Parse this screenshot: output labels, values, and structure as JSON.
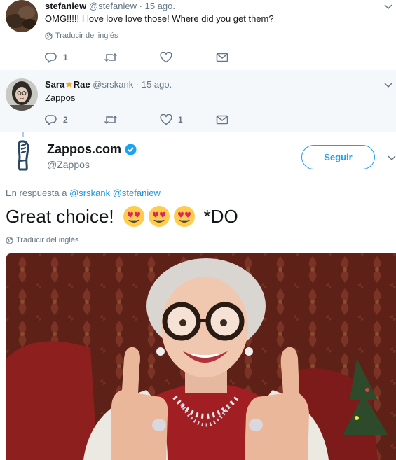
{
  "thread": {
    "replies": [
      {
        "display_name": "stefaniew",
        "handle": "@stefaniew",
        "separator": "·",
        "time": "15 ago.",
        "text": "OMG!!!!!  I love love love those!  Where did you get them?",
        "translate_label": "Traducir del inglés",
        "reply_count": "1",
        "retweet_count": "",
        "like_count": ""
      },
      {
        "display_name_part1": "Sara",
        "display_name_part2": "Rae",
        "handle": "@srskank",
        "separator": "·",
        "time": "15 ago.",
        "text": "Zappos",
        "reply_count": "2",
        "retweet_count": "",
        "like_count": "1"
      }
    ]
  },
  "main_tweet": {
    "display_name": "Zappos.com",
    "handle": "@Zappos",
    "follow_label": "Seguir",
    "in_reply_prefix": "En respuesta a",
    "mentions": [
      "@srskank",
      "@stefaniew"
    ],
    "text_before": "Great choice!",
    "emojis": [
      "heart-eyes-emoji",
      "heart-eyes-emoji",
      "heart-eyes-emoji"
    ],
    "text_after": "*DO",
    "translate_label": "Traducir del inglés"
  },
  "colors": {
    "accent": "#1da1f2",
    "mention": "#1b95e0",
    "muted": "#657786",
    "thread_line": "#a6d0ee",
    "highlight_bg": "#f5f8fa"
  }
}
